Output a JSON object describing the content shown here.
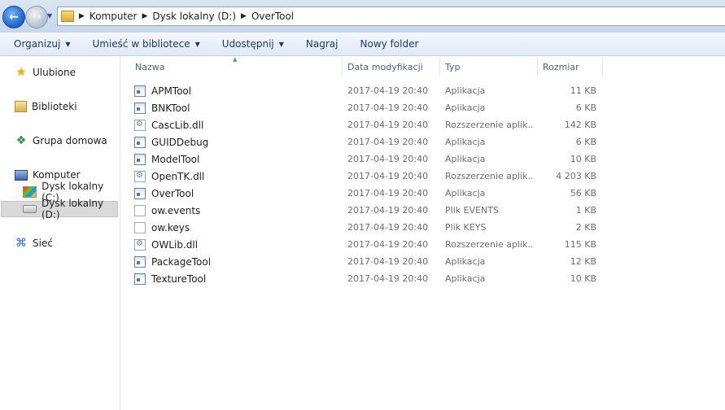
{
  "address": {
    "crumbs": [
      "Komputer",
      "Dysk lokalny (D:)",
      "OverTool"
    ]
  },
  "toolbar": {
    "organize": "Organizuj",
    "include_library": "Umieść w bibliotece",
    "share": "Udostępnij",
    "burn": "Nagraj",
    "new_folder": "Nowy folder"
  },
  "sidebar": {
    "favorites": "Ulubione",
    "libraries": "Biblioteki",
    "homegroup": "Grupa domowa",
    "computer": "Komputer",
    "drive_c": "Dysk lokalny (C:)",
    "drive_d": "Dysk lokalny (D:)",
    "network": "Sieć"
  },
  "columns": {
    "name": "Nazwa",
    "date": "Data modyfikacji",
    "type": "Typ",
    "size": "Rozmiar"
  },
  "files": [
    {
      "name": "APMTool",
      "date": "2017-04-19 20:40",
      "type": "Aplikacja",
      "size": "11 KB",
      "icon": "app"
    },
    {
      "name": "BNKTool",
      "date": "2017-04-19 20:40",
      "type": "Aplikacja",
      "size": "6 KB",
      "icon": "app"
    },
    {
      "name": "CascLib.dll",
      "date": "2017-04-19 20:40",
      "type": "Rozszerzenie aplik...",
      "size": "142 KB",
      "icon": "dll"
    },
    {
      "name": "GUIDDebug",
      "date": "2017-04-19 20:40",
      "type": "Aplikacja",
      "size": "6 KB",
      "icon": "app"
    },
    {
      "name": "ModelTool",
      "date": "2017-04-19 20:40",
      "type": "Aplikacja",
      "size": "10 KB",
      "icon": "app"
    },
    {
      "name": "OpenTK.dll",
      "date": "2017-04-19 20:40",
      "type": "Rozszerzenie aplik...",
      "size": "4 203 KB",
      "icon": "dll"
    },
    {
      "name": "OverTool",
      "date": "2017-04-19 20:40",
      "type": "Aplikacja",
      "size": "56 KB",
      "icon": "app"
    },
    {
      "name": "ow.events",
      "date": "2017-04-19 20:40",
      "type": "Plik EVENTS",
      "size": "1 KB",
      "icon": "file"
    },
    {
      "name": "ow.keys",
      "date": "2017-04-19 20:40",
      "type": "Plik KEYS",
      "size": "2 KB",
      "icon": "file"
    },
    {
      "name": "OWLib.dll",
      "date": "2017-04-19 20:40",
      "type": "Rozszerzenie aplik...",
      "size": "115 KB",
      "icon": "dll"
    },
    {
      "name": "PackageTool",
      "date": "2017-04-19 20:40",
      "type": "Aplikacja",
      "size": "12 KB",
      "icon": "app"
    },
    {
      "name": "TextureTool",
      "date": "2017-04-19 20:40",
      "type": "Aplikacja",
      "size": "10 KB",
      "icon": "app"
    }
  ]
}
